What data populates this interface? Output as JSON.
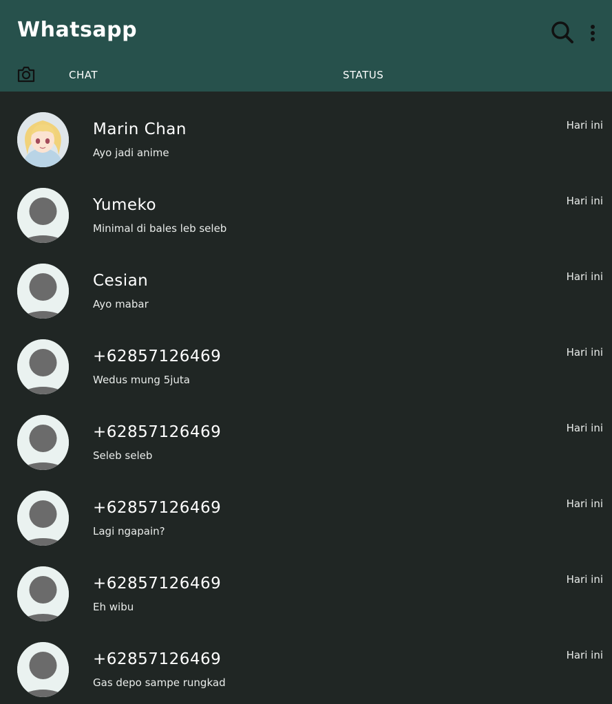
{
  "app": {
    "title": "Whatsapp"
  },
  "toolbar": {
    "search_icon": "search-icon",
    "more_icon": "more-vertical-icon"
  },
  "tabs": {
    "camera_icon": "camera-icon",
    "chat_label": "CHAT",
    "status_label": "STATUS"
  },
  "colors": {
    "appbar": "#27514c",
    "background": "#202624",
    "text": "#ffffff",
    "avatar_placeholder_bg": "#eaf2f0",
    "avatar_placeholder_fg": "#6b6b6b"
  },
  "chats": [
    {
      "name": "Marin Chan",
      "message": "Ayo jadi anime",
      "time": "Hari ini",
      "avatar": "anime-girl-photo"
    },
    {
      "name": "Yumeko",
      "message": "Minimal di bales leb seleb",
      "time": "Hari ini",
      "avatar": "default-person"
    },
    {
      "name": "Cesian",
      "message": "Ayo mabar",
      "time": "Hari ini",
      "avatar": "default-person"
    },
    {
      "name": "+62857126469",
      "message": "Wedus mung 5juta",
      "time": "Hari ini",
      "avatar": "default-person"
    },
    {
      "name": "+62857126469",
      "message": "Seleb seleb",
      "time": "Hari ini",
      "avatar": "default-person"
    },
    {
      "name": "+62857126469",
      "message": "Lagi ngapain?",
      "time": "Hari ini",
      "avatar": "default-person"
    },
    {
      "name": "+62857126469",
      "message": "Eh wibu",
      "time": "Hari ini",
      "avatar": "default-person"
    },
    {
      "name": "+62857126469",
      "message": "Gas depo sampe rungkad",
      "time": "Hari ini",
      "avatar": "default-person"
    }
  ]
}
